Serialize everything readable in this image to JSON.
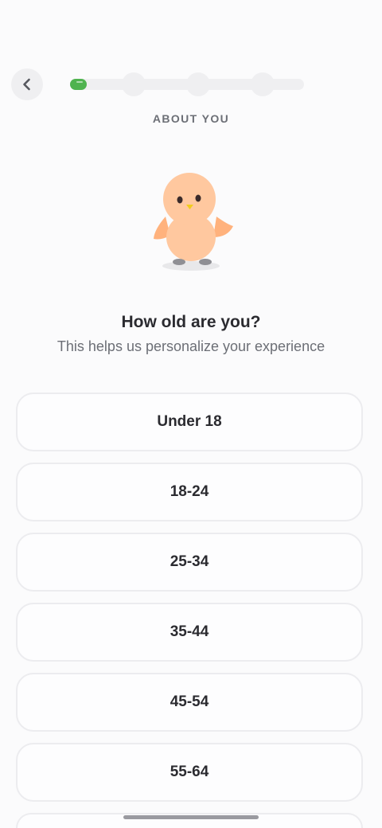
{
  "header": {
    "back_icon": "chevron-left-icon",
    "progress": {
      "current_step": 1,
      "total_steps": 4,
      "fill_fraction": 0.07
    },
    "section_label": "ABOUT YOU"
  },
  "mascot": {
    "icon": "peach-bird-mascot"
  },
  "question": {
    "title": "How old are you?",
    "subtitle": "This helps us personalize your experience"
  },
  "options": [
    {
      "label": "Under 18"
    },
    {
      "label": "18-24"
    },
    {
      "label": "25-34"
    },
    {
      "label": "35-44"
    },
    {
      "label": "45-54"
    },
    {
      "label": "55-64"
    },
    {
      "label": ""
    }
  ],
  "colors": {
    "progress_fill": "#4fb34f",
    "track": "#efeff1",
    "option_border": "#ececef",
    "mascot_body": "#ffc89f"
  }
}
